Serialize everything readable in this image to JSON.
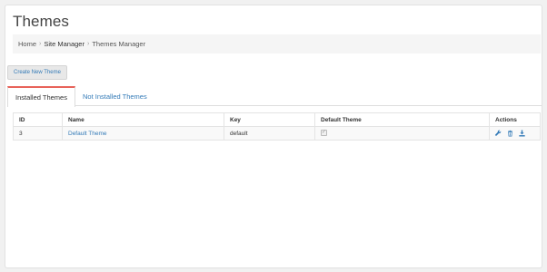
{
  "page": {
    "title": "Themes"
  },
  "breadcrumb": [
    {
      "label": "Home"
    },
    {
      "label": "Site Manager"
    },
    {
      "label": "Themes Manager"
    }
  ],
  "breadcrumb_separator": "›",
  "toolbar": {
    "create_label": "Create New Theme"
  },
  "tabs": [
    {
      "label": "Installed Themes",
      "active": true
    },
    {
      "label": "Not Installed Themes",
      "active": false
    }
  ],
  "table": {
    "headers": {
      "id": "ID",
      "name": "Name",
      "key": "Key",
      "default": "Default Theme",
      "actions": "Actions"
    },
    "rows": [
      {
        "id": "3",
        "name": "Default Theme",
        "key": "default",
        "default_checked": true,
        "actions": [
          "wrench-icon",
          "trash-icon",
          "download-icon"
        ]
      }
    ]
  },
  "colors": {
    "accent": "#337ab7",
    "tab_indicator": "#e8635a",
    "panel_bg": "#ffffff",
    "page_bg": "#f1f1f1"
  }
}
